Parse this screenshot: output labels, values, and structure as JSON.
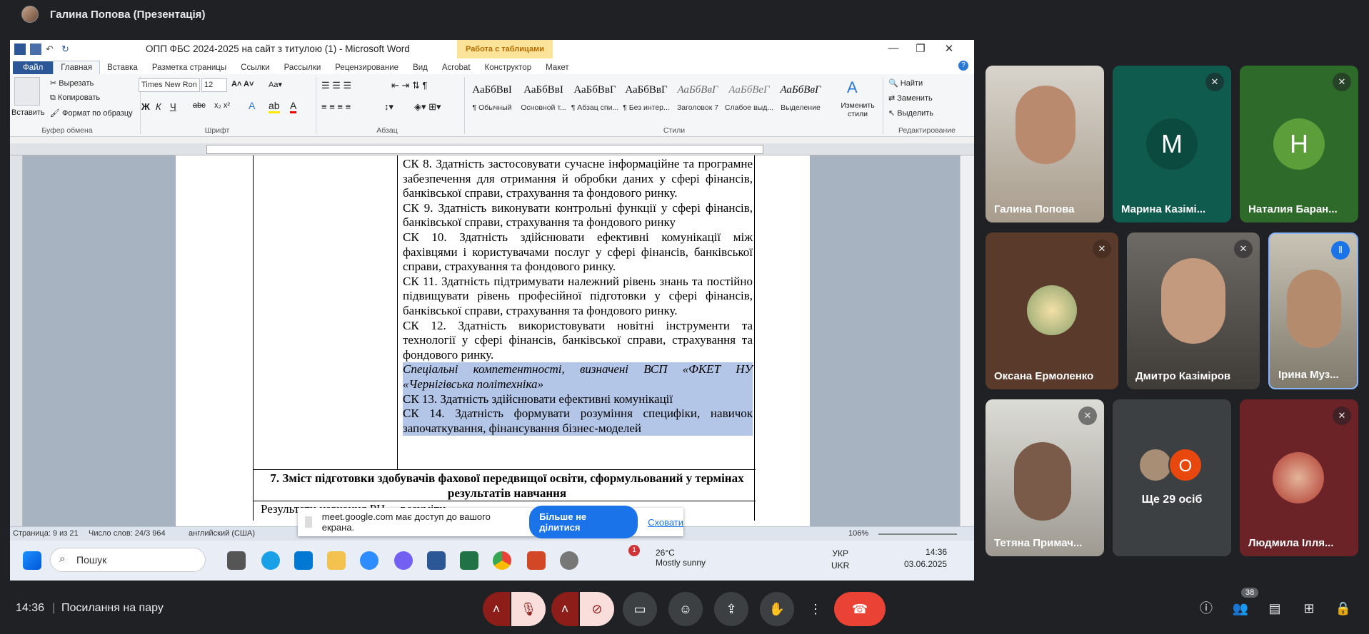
{
  "meet": {
    "presenter_title": "Галина Попова (Презентація)",
    "time": "14:36",
    "meeting_title": "Посилання на пару",
    "people_count": "38"
  },
  "word": {
    "window_title": "ОПП ФБС 2024-2025 на сайт з титулою (1) - Microsoft Word",
    "table_tools_label": "Работа с таблицами",
    "tabs": [
      "Файл",
      "Главная",
      "Вставка",
      "Разметка страницы",
      "Ссылки",
      "Рассылки",
      "Рецензирование",
      "Вид",
      "Acrobat",
      "Конструктор",
      "Макет"
    ],
    "clipboard": {
      "paste": "Вставить",
      "cut": "Вырезать",
      "copy": "Копировать",
      "format_painter": "Формат по образцу",
      "group": "Буфер обмена"
    },
    "font": {
      "name": "Times New Ron",
      "size": "12",
      "group": "Шрифт"
    },
    "paragraph_group": "Абзац",
    "styles": [
      {
        "sample": "АаБбВвІ",
        "name": "¶ Обычный"
      },
      {
        "sample": "АаБбВвІ",
        "name": "Основной т..."
      },
      {
        "sample": "АаБбВвГ",
        "name": "¶ Абзац спи..."
      },
      {
        "sample": "АаБбВвГ",
        "name": "¶ Без интер..."
      },
      {
        "sample": "АаБбВвГ",
        "name": "Заголовок 7"
      },
      {
        "sample": "АаБбВеГ",
        "name": "Слабое выд..."
      },
      {
        "sample": "АаБбВвГ",
        "name": "Выделение"
      }
    ],
    "change_styles": "Изменить стили",
    "styles_group": "Стили",
    "editing": {
      "find": "Найти",
      "replace": "Заменить",
      "select": "Выделить",
      "group": "Редактирование"
    },
    "paragraphs": [
      {
        "text": "СК 8. Здатність застосовувати сучасне інформаційне та програмне забезпечення для отримання й обробки даних у сфері фінансів, банківської справи, страхування та фондового ринку.",
        "selected": false,
        "italic": false
      },
      {
        "text": "СК 9. Здатність виконувати контрольні функції у сфері фінансів, банківської справи, страхування та фондового ринку",
        "selected": false,
        "italic": false
      },
      {
        "text": "СК 10. Здатність здійснювати ефективні комунікації між фахівцями і користувачами послуг у сфері фінансів, банківської справи, страхування та фондового ринку.",
        "selected": false,
        "italic": false
      },
      {
        "text": "СК 11. Здатність підтримувати належний рівень знань та постійно підвищувати рівень професійної підготовки у сфері фінансів, банківської справи, страхування та фондового ринку.",
        "selected": false,
        "italic": false
      },
      {
        "text": "СК 12. Здатність використовувати новітні інструменти та технології у сфері фінансів, банківської справи, страхування та фондового ринку.",
        "selected": false,
        "italic": false
      },
      {
        "text": "Спеціальні компетентності, визначені ВСП «ФКЕТ НУ «Чернігівська політехніка»",
        "selected": true,
        "italic": true
      },
      {
        "text": "СК 13. Здатність здійснювати ефективні комунікації",
        "selected": true,
        "italic": false
      },
      {
        "text": "СК 14. Здатність формувати розуміння специфіки, навичок започаткування, фінансування бізнес-моделей",
        "selected": true,
        "italic": false
      }
    ],
    "heading7": "7. Зміст підготовки здобувачів фахової передвищої освіти, сформульований у термінах результатів навчання",
    "results_row": "Результати навчання РН ... розуміти",
    "status": {
      "page": "Страница: 9 из 21",
      "words": "Число слов: 24/3 964",
      "lang": "английский (США)",
      "zoom": "106%"
    }
  },
  "share_notice": {
    "text": "meet.google.com має доступ до вашого екрана.",
    "stop_button": "Більше не ділитися",
    "hide_link": "Сховати"
  },
  "taskbar": {
    "search_placeholder": "Пошук",
    "weather_temp": "26°C",
    "weather_desc": "Mostly sunny",
    "weather_badge": "1",
    "lang1": "УКР",
    "lang2": "UKR",
    "time": "14:36",
    "date": "03.06.2025"
  },
  "participants": [
    {
      "name": "Галина Попова",
      "muted": false
    },
    {
      "name": "Марина Казімі...",
      "letter": "M",
      "muted": true,
      "color": "#0f5c4e"
    },
    {
      "name": "Наталия Баран...",
      "letter": "H",
      "muted": true,
      "color": "#5c9e3a"
    },
    {
      "name": "Оксана Ермоленко",
      "muted": true
    },
    {
      "name": "Дмитро Казіміров",
      "muted": true
    },
    {
      "name": "Ірина Муз...",
      "muted": false,
      "speaking": true
    },
    {
      "name": "Тетяна Примач...",
      "muted": true
    },
    {
      "name": "Ще 29 осіб",
      "letter": "О",
      "color": "#e8470e"
    },
    {
      "name": "Людмила Ілля...",
      "muted": true
    }
  ],
  "colors": {
    "accent": "#1a73e8",
    "end_call": "#ea4335",
    "word_blue": "#2b5797",
    "selection": "#b3c6e7"
  }
}
